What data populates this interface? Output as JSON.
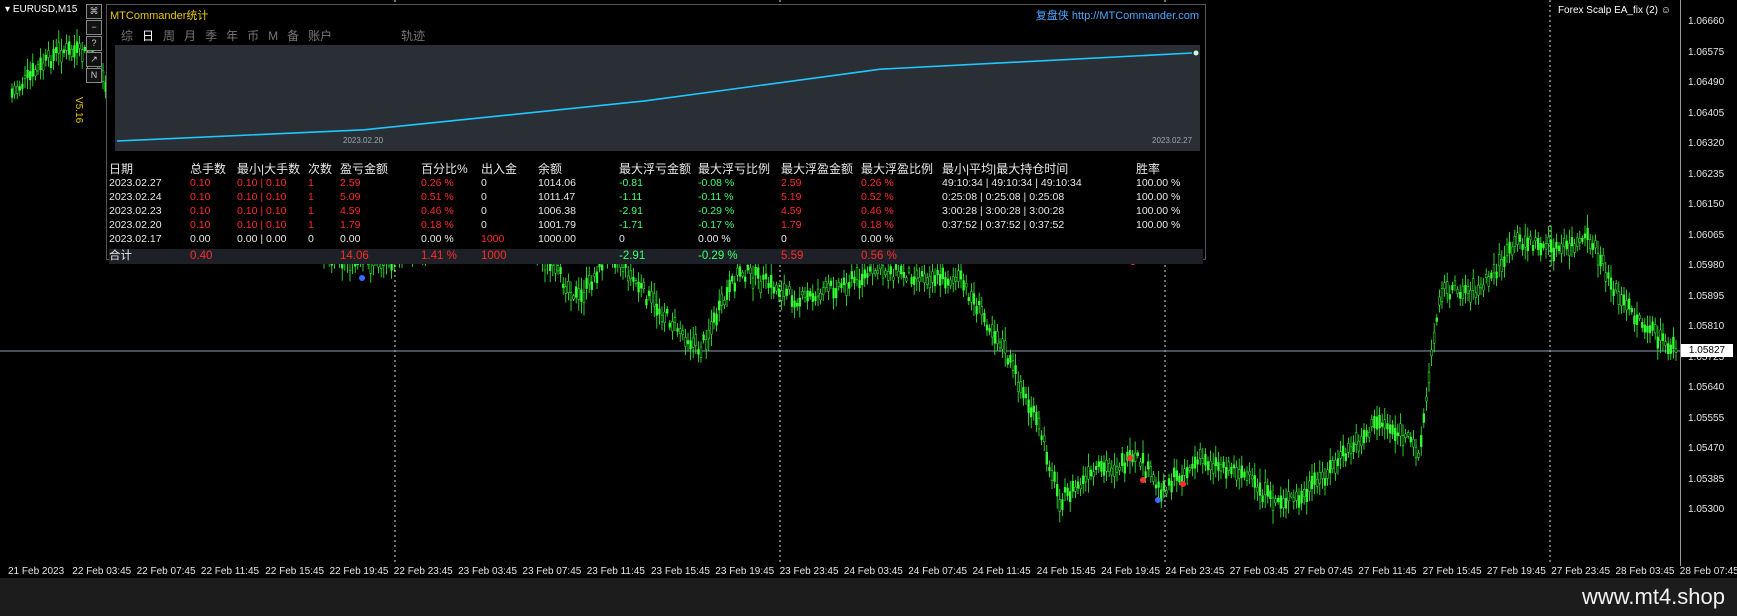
{
  "chart": {
    "symbol": "EURUSD,M15",
    "ea_name": "Forex Scalp EA_fix (2)",
    "smile_icon": "smile-icon",
    "version": "V5.16",
    "current_price": "1.05827",
    "price_labels": [
      "1.06660",
      "1.06575",
      "1.06490",
      "1.06405",
      "1.06320",
      "1.06235",
      "1.06150",
      "1.06065",
      "1.05980",
      "1.05895",
      "1.05810",
      "1.05725",
      "1.05640",
      "1.05555",
      "1.05470",
      "1.05385",
      "1.05300"
    ],
    "time_labels": [
      "21 Feb 2023",
      "22 Feb 03:45",
      "22 Feb 07:45",
      "22 Feb 11:45",
      "22 Feb 15:45",
      "22 Feb 19:45",
      "22 Feb 23:45",
      "23 Feb 03:45",
      "23 Feb 07:45",
      "23 Feb 11:45",
      "23 Feb 15:45",
      "23 Feb 19:45",
      "23 Feb 23:45",
      "24 Feb 03:45",
      "24 Feb 07:45",
      "24 Feb 11:45",
      "24 Feb 15:45",
      "24 Feb 19:45",
      "24 Feb 23:45",
      "27 Feb 03:45",
      "27 Feb 07:45",
      "27 Feb 11:45",
      "27 Feb 15:45",
      "27 Feb 19:45",
      "27 Feb 23:45",
      "28 Feb 03:45",
      "28 Feb 07:45"
    ],
    "toolbox": [
      "⌘",
      "−",
      "?",
      "↗",
      "N"
    ],
    "candle_color": "#33ff33"
  },
  "panel": {
    "title": "MTCommander统计",
    "brand_cn": "复盘侠",
    "brand_url": "http://MTCommander.com",
    "tabs": [
      "综",
      "日",
      "周",
      "月",
      "季",
      "年",
      "币",
      "M",
      "备",
      "账户",
      "轨迹"
    ],
    "active_tab": "日",
    "equity": {
      "start_date": "2023.02.20",
      "end_date": "2023.02.27",
      "line_color": "#1ec8ff",
      "values": [
        1000.0,
        1001.79,
        1006.38,
        1011.47,
        1014.06
      ]
    },
    "stats": {
      "headers": [
        "日期",
        "总手数",
        "最小|大手数",
        "次数",
        "盈亏金额",
        "百分比%",
        "出入金",
        "余额",
        "最大浮亏金额",
        "最大浮亏比例",
        "最大浮盈金额",
        "最大浮盈比例",
        "最小|平均|最大持仓时间",
        "胜率"
      ],
      "rows": [
        [
          "2023.02.27",
          "0.10",
          "0.10 | 0.10",
          "1",
          "2.59",
          "0.26 %",
          "0",
          "1014.06",
          "-0.81",
          "-0.08 %",
          "2.59",
          "0.26 %",
          "49:10:34 | 49:10:34 | 49:10:34",
          "100.00 %"
        ],
        [
          "2023.02.24",
          "0.10",
          "0.10 | 0.10",
          "1",
          "5.09",
          "0.51 %",
          "0",
          "1011.47",
          "-1.11",
          "-0.11 %",
          "5.19",
          "0.52 %",
          "0:25:08 | 0:25:08 | 0:25:08",
          "100.00 %"
        ],
        [
          "2023.02.23",
          "0.10",
          "0.10 | 0.10",
          "1",
          "4.59",
          "0.46 %",
          "0",
          "1006.38",
          "-2.91",
          "-0.29 %",
          "4.59",
          "0.46 %",
          "3:00:28 | 3:00:28 | 3:00:28",
          "100.00 %"
        ],
        [
          "2023.02.20",
          "0.10",
          "0.10 | 0.10",
          "1",
          "1.79",
          "0.18 %",
          "0",
          "1001.79",
          "-1.71",
          "-0.17 %",
          "1.79",
          "0.18 %",
          "0:37:52 | 0:37:52 | 0:37:52",
          "100.00 %"
        ],
        [
          "2023.02.17",
          "0.00",
          "0.00 | 0.00",
          "0",
          "0.00",
          "0.00 %",
          "1000",
          "1000.00",
          "0",
          "0.00 %",
          "0",
          "0.00 %",
          "",
          ""
        ]
      ],
      "total": [
        "合计",
        "0.40",
        "",
        "",
        "14.06",
        "1.41 %",
        "1000",
        "",
        "-2.91",
        "-0.29 %",
        "5.59",
        "0.56 %",
        "",
        ""
      ]
    }
  },
  "footer": {
    "site": "www.mt4.shop"
  }
}
